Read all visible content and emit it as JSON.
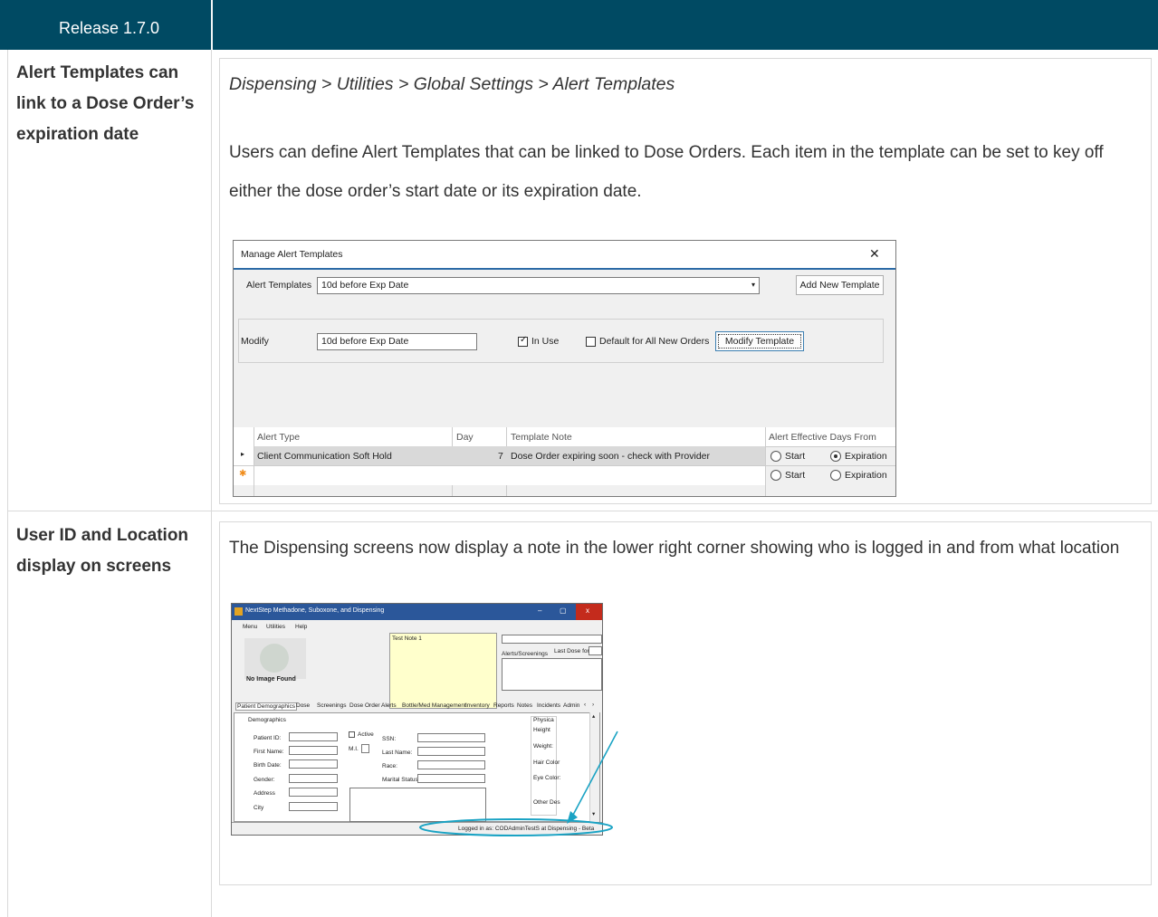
{
  "header": {
    "release": "Release 1.7.0"
  },
  "rows": [
    {
      "feature": "Alert Templates can link to a Dose Order’s expiration date",
      "breadcrumb": "Dispensing > Utilities > Global Settings > Alert Templates",
      "description": "Users can define Alert Templates that can be linked to Dose Orders.  Each item in the template can be set to key off either the dose order’s start date or its expiration date."
    },
    {
      "feature": "User ID and Location display on screens",
      "description": "The Dispensing screens now display a note in the lower right corner showing who is logged in and from what location"
    }
  ],
  "dialog": {
    "title": "Manage Alert Templates",
    "close": "✕",
    "templates_label": "Alert Templates",
    "templates_value": "10d before Exp Date",
    "add_button": "Add New Template",
    "modify_label": "Modify",
    "modify_value": "10d before Exp Date",
    "in_use_label": "In Use",
    "in_use_checked": true,
    "default_label": "Default for All New Orders",
    "default_checked": false,
    "modify_button": "Modify Template",
    "grid": {
      "columns": [
        "Alert Type",
        "Day",
        "Template Note",
        "Alert Effective Days From"
      ],
      "rows": [
        {
          "type": "Client Communication Soft Hold",
          "day": "7",
          "note": "Dose Order expiring soon - check with Provider",
          "start": "Start",
          "expiration": "Expiration",
          "selected": "expiration"
        },
        {
          "type": "",
          "day": "",
          "note": "",
          "start": "Start",
          "expiration": "Expiration",
          "selected": ""
        }
      ]
    }
  },
  "app": {
    "title": "NextStep Methadone, Suboxone, and Dispensing",
    "menu": [
      "Menu",
      "Utilities",
      "Help"
    ],
    "no_image": "No Image Found",
    "note_title": "Test Note 1",
    "alerts_label": "Alerts/Screenings",
    "last_dose_label": "Last Dose for",
    "tabs": [
      "Patient Demographics",
      "Dose",
      "Screenings",
      "Dose Order",
      "Alerts",
      "Bottle/Med Management",
      "Inventory",
      "Reports",
      "Notes",
      "Incidents",
      "Admin"
    ],
    "section": "Demographics",
    "left_fields": [
      "Patient ID:",
      "First Name:",
      "Birth Date:",
      "Gender:",
      "Address",
      "City"
    ],
    "active_label": "Active",
    "mi_label": "M.I.",
    "mid_fields": [
      "SSN:",
      "Last Name:",
      "Race:",
      "Marital Status:"
    ],
    "right_fields": [
      "Physica",
      "Weight:",
      "Hair Color",
      "Eye Color:",
      "Other Des"
    ],
    "right_extra": "Height",
    "status": "Logged in as: CODAdminTestS at Dispensing - Beta",
    "accent": "#1aa3c4"
  }
}
